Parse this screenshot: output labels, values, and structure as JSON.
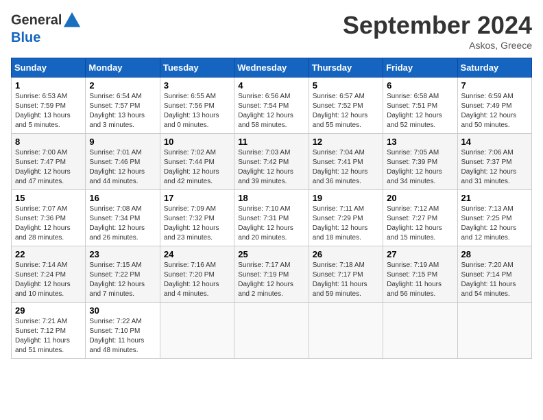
{
  "header": {
    "logo_line1": "General",
    "logo_line2": "Blue",
    "month": "September 2024",
    "location": "Askos, Greece"
  },
  "weekdays": [
    "Sunday",
    "Monday",
    "Tuesday",
    "Wednesday",
    "Thursday",
    "Friday",
    "Saturday"
  ],
  "weeks": [
    [
      {
        "day": "1",
        "info": "Sunrise: 6:53 AM\nSunset: 7:59 PM\nDaylight: 13 hours\nand 5 minutes."
      },
      {
        "day": "2",
        "info": "Sunrise: 6:54 AM\nSunset: 7:57 PM\nDaylight: 13 hours\nand 3 minutes."
      },
      {
        "day": "3",
        "info": "Sunrise: 6:55 AM\nSunset: 7:56 PM\nDaylight: 13 hours\nand 0 minutes."
      },
      {
        "day": "4",
        "info": "Sunrise: 6:56 AM\nSunset: 7:54 PM\nDaylight: 12 hours\nand 58 minutes."
      },
      {
        "day": "5",
        "info": "Sunrise: 6:57 AM\nSunset: 7:52 PM\nDaylight: 12 hours\nand 55 minutes."
      },
      {
        "day": "6",
        "info": "Sunrise: 6:58 AM\nSunset: 7:51 PM\nDaylight: 12 hours\nand 52 minutes."
      },
      {
        "day": "7",
        "info": "Sunrise: 6:59 AM\nSunset: 7:49 PM\nDaylight: 12 hours\nand 50 minutes."
      }
    ],
    [
      {
        "day": "8",
        "info": "Sunrise: 7:00 AM\nSunset: 7:47 PM\nDaylight: 12 hours\nand 47 minutes."
      },
      {
        "day": "9",
        "info": "Sunrise: 7:01 AM\nSunset: 7:46 PM\nDaylight: 12 hours\nand 44 minutes."
      },
      {
        "day": "10",
        "info": "Sunrise: 7:02 AM\nSunset: 7:44 PM\nDaylight: 12 hours\nand 42 minutes."
      },
      {
        "day": "11",
        "info": "Sunrise: 7:03 AM\nSunset: 7:42 PM\nDaylight: 12 hours\nand 39 minutes."
      },
      {
        "day": "12",
        "info": "Sunrise: 7:04 AM\nSunset: 7:41 PM\nDaylight: 12 hours\nand 36 minutes."
      },
      {
        "day": "13",
        "info": "Sunrise: 7:05 AM\nSunset: 7:39 PM\nDaylight: 12 hours\nand 34 minutes."
      },
      {
        "day": "14",
        "info": "Sunrise: 7:06 AM\nSunset: 7:37 PM\nDaylight: 12 hours\nand 31 minutes."
      }
    ],
    [
      {
        "day": "15",
        "info": "Sunrise: 7:07 AM\nSunset: 7:36 PM\nDaylight: 12 hours\nand 28 minutes."
      },
      {
        "day": "16",
        "info": "Sunrise: 7:08 AM\nSunset: 7:34 PM\nDaylight: 12 hours\nand 26 minutes."
      },
      {
        "day": "17",
        "info": "Sunrise: 7:09 AM\nSunset: 7:32 PM\nDaylight: 12 hours\nand 23 minutes."
      },
      {
        "day": "18",
        "info": "Sunrise: 7:10 AM\nSunset: 7:31 PM\nDaylight: 12 hours\nand 20 minutes."
      },
      {
        "day": "19",
        "info": "Sunrise: 7:11 AM\nSunset: 7:29 PM\nDaylight: 12 hours\nand 18 minutes."
      },
      {
        "day": "20",
        "info": "Sunrise: 7:12 AM\nSunset: 7:27 PM\nDaylight: 12 hours\nand 15 minutes."
      },
      {
        "day": "21",
        "info": "Sunrise: 7:13 AM\nSunset: 7:25 PM\nDaylight: 12 hours\nand 12 minutes."
      }
    ],
    [
      {
        "day": "22",
        "info": "Sunrise: 7:14 AM\nSunset: 7:24 PM\nDaylight: 12 hours\nand 10 minutes."
      },
      {
        "day": "23",
        "info": "Sunrise: 7:15 AM\nSunset: 7:22 PM\nDaylight: 12 hours\nand 7 minutes."
      },
      {
        "day": "24",
        "info": "Sunrise: 7:16 AM\nSunset: 7:20 PM\nDaylight: 12 hours\nand 4 minutes."
      },
      {
        "day": "25",
        "info": "Sunrise: 7:17 AM\nSunset: 7:19 PM\nDaylight: 12 hours\nand 2 minutes."
      },
      {
        "day": "26",
        "info": "Sunrise: 7:18 AM\nSunset: 7:17 PM\nDaylight: 11 hours\nand 59 minutes."
      },
      {
        "day": "27",
        "info": "Sunrise: 7:19 AM\nSunset: 7:15 PM\nDaylight: 11 hours\nand 56 minutes."
      },
      {
        "day": "28",
        "info": "Sunrise: 7:20 AM\nSunset: 7:14 PM\nDaylight: 11 hours\nand 54 minutes."
      }
    ],
    [
      {
        "day": "29",
        "info": "Sunrise: 7:21 AM\nSunset: 7:12 PM\nDaylight: 11 hours\nand 51 minutes."
      },
      {
        "day": "30",
        "info": "Sunrise: 7:22 AM\nSunset: 7:10 PM\nDaylight: 11 hours\nand 48 minutes."
      },
      {
        "day": "",
        "info": ""
      },
      {
        "day": "",
        "info": ""
      },
      {
        "day": "",
        "info": ""
      },
      {
        "day": "",
        "info": ""
      },
      {
        "day": "",
        "info": ""
      }
    ]
  ]
}
